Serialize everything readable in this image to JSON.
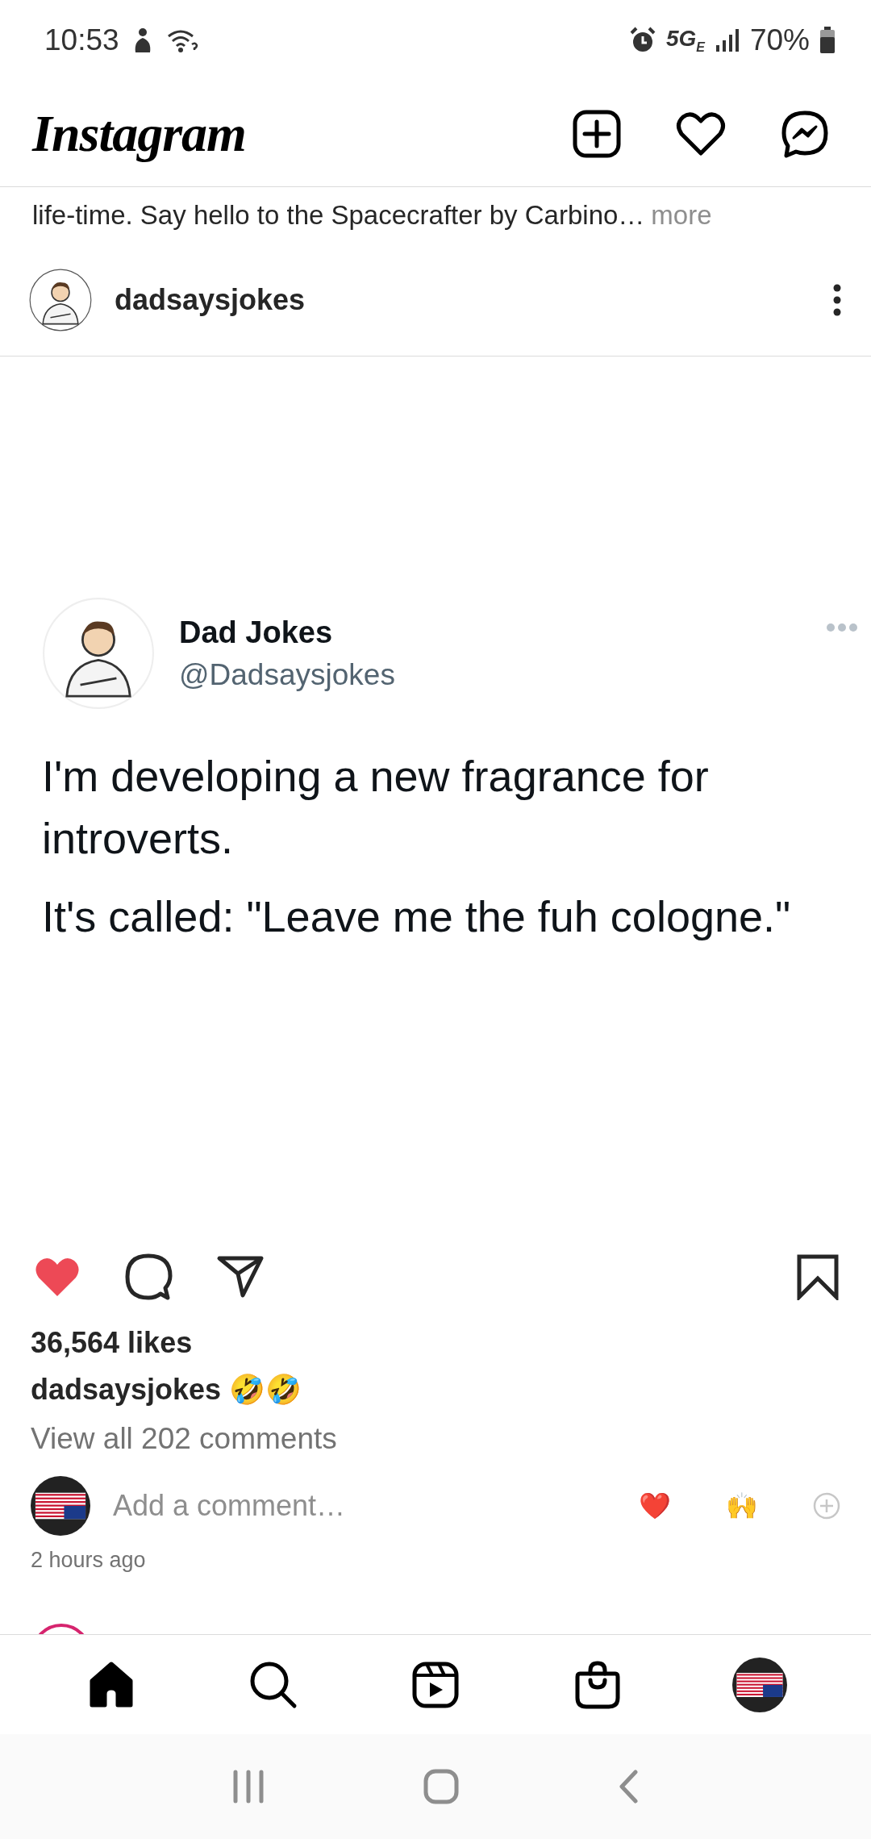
{
  "status_bar": {
    "time": "10:53",
    "network": "5G$_{E}$",
    "battery": "70%"
  },
  "header": {
    "logo": "Instagram"
  },
  "caption_fragment": {
    "text": "life-time. Say hello to the Spacecrafter by Carbino…",
    "more": "more"
  },
  "post": {
    "username": "dadsaysjokes",
    "tweet": {
      "name": "Dad Jokes",
      "handle": "@Dadsaysjokes",
      "paragraphs": [
        "I'm developing a new fragrance for introverts.",
        "It's called: \"Leave me the fuh cologne.\""
      ]
    },
    "liked": true,
    "saved": false,
    "likes": "36,564 likes",
    "caption": {
      "username": "dadsaysjokes",
      "text": "🤣🤣"
    },
    "view_comments": "View all 202 comments",
    "comment_field": {
      "placeholder": "Add a comment…"
    },
    "quick_reactions": [
      "❤️",
      "🙌"
    ],
    "time": "2 hours ago"
  },
  "bottom_nav": [
    {
      "kind": "home",
      "selected": true
    },
    {
      "kind": "search",
      "selected": false
    },
    {
      "kind": "reels",
      "selected": false
    },
    {
      "kind": "shop",
      "selected": false
    },
    {
      "kind": "profile",
      "selected": false
    }
  ]
}
